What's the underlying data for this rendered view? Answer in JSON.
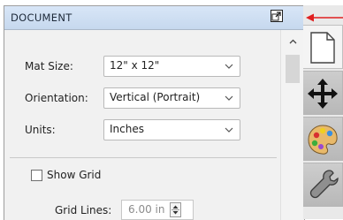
{
  "panel": {
    "title": "DOCUMENT",
    "popout_icon": "popout-icon"
  },
  "document": {
    "mat_size": {
      "label": "Mat Size:",
      "value": "12\" x 12\""
    },
    "orientation": {
      "label": "Orientation:",
      "value": "Vertical (Portrait)"
    },
    "units": {
      "label": "Units:",
      "value": "Inches"
    },
    "show_grid": {
      "label": "Show Grid",
      "checked": false
    },
    "grid_lines": {
      "label": "Grid Lines:",
      "value": "6.00 in"
    }
  },
  "sidebar": {
    "tabs": [
      {
        "name": "document",
        "icon": "page-icon",
        "active": true
      },
      {
        "name": "move",
        "icon": "move-arrows-icon",
        "active": false
      },
      {
        "name": "color",
        "icon": "palette-icon",
        "active": false
      },
      {
        "name": "tools",
        "icon": "wrench-icon",
        "active": false
      }
    ]
  },
  "colors": {
    "header_bg": "#cfe0f5",
    "panel_bg": "#f1f1f1",
    "callout_arrow": "#e02020"
  }
}
